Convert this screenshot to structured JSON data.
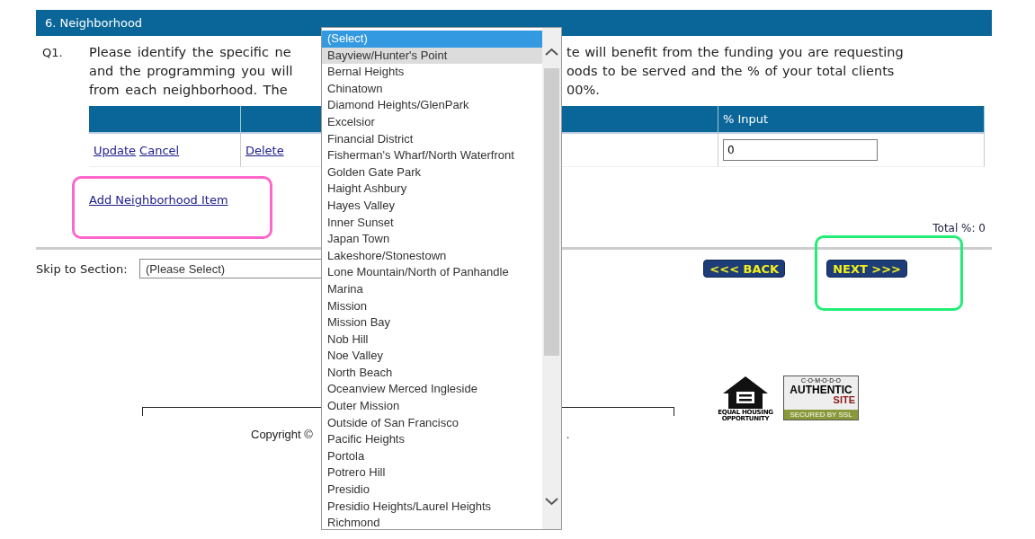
{
  "section": {
    "title": "6. Neighborhood"
  },
  "question": {
    "number": "Q1.",
    "left_lines": [
      "Please identify the specific ne",
      "and the programming you will",
      "from each neighborhood. The"
    ],
    "right_lines": [
      "te will benefit from the funding you are requesting",
      "oods to be served and the % of your total clients",
      "00%."
    ]
  },
  "table": {
    "columns": [
      "",
      "",
      "% Input"
    ],
    "rows": [
      {
        "actions": [
          "Update",
          "Cancel"
        ],
        "delete": "Delete",
        "value": "0"
      }
    ]
  },
  "add_link": "Add Neighborhood Item",
  "total": "Total %: 0",
  "skip": {
    "label": "Skip to Section:",
    "value": "(Please Select)"
  },
  "buttons": [
    {
      "label": "<<< BACK"
    },
    {
      "label": "NEXT >>>"
    }
  ],
  "footer": {
    "copyright": "Copyright ©",
    "tail": "."
  },
  "housing_logo": {
    "lines": [
      "EQUAL HOUSING",
      "OPPORTUNITY"
    ]
  },
  "ssl_badge": {
    "top": "C·O·M·O·D·O",
    "main": "AUTHENTIC",
    "sub": "SITE",
    "bottom": "SECURED BY SSL"
  },
  "dropdown": {
    "options": [
      {
        "label": "(Select)",
        "selected": true,
        "hovered": false
      },
      {
        "label": "Bayview/Hunter's Point",
        "selected": false,
        "hovered": true
      },
      {
        "label": "Bernal Heights",
        "selected": false,
        "hovered": false
      },
      {
        "label": "Chinatown",
        "selected": false,
        "hovered": false
      },
      {
        "label": "Diamond Heights/GlenPark",
        "selected": false,
        "hovered": false
      },
      {
        "label": "Excelsior",
        "selected": false,
        "hovered": false
      },
      {
        "label": "Financial District",
        "selected": false,
        "hovered": false
      },
      {
        "label": "Fisherman's Wharf/North Waterfront",
        "selected": false,
        "hovered": false
      },
      {
        "label": "Golden Gate Park",
        "selected": false,
        "hovered": false
      },
      {
        "label": "Haight Ashbury",
        "selected": false,
        "hovered": false
      },
      {
        "label": "Hayes Valley",
        "selected": false,
        "hovered": false
      },
      {
        "label": "Inner Sunset",
        "selected": false,
        "hovered": false
      },
      {
        "label": "Japan Town",
        "selected": false,
        "hovered": false
      },
      {
        "label": "Lakeshore/Stonestown",
        "selected": false,
        "hovered": false
      },
      {
        "label": "Lone Mountain/North of Panhandle",
        "selected": false,
        "hovered": false
      },
      {
        "label": "Marina",
        "selected": false,
        "hovered": false
      },
      {
        "label": "Mission",
        "selected": false,
        "hovered": false
      },
      {
        "label": "Mission Bay",
        "selected": false,
        "hovered": false
      },
      {
        "label": "Nob Hill",
        "selected": false,
        "hovered": false
      },
      {
        "label": "Noe Valley",
        "selected": false,
        "hovered": false
      },
      {
        "label": "North Beach",
        "selected": false,
        "hovered": false
      },
      {
        "label": "Oceanview Merced Ingleside",
        "selected": false,
        "hovered": false
      },
      {
        "label": "Outer Mission",
        "selected": false,
        "hovered": false
      },
      {
        "label": "Outside of San Francisco",
        "selected": false,
        "hovered": false
      },
      {
        "label": "Pacific Heights",
        "selected": false,
        "hovered": false
      },
      {
        "label": "Portola",
        "selected": false,
        "hovered": false
      },
      {
        "label": "Potrero Hill",
        "selected": false,
        "hovered": false
      },
      {
        "label": "Presidio",
        "selected": false,
        "hovered": false
      },
      {
        "label": "Presidio Heights/Laurel Heights",
        "selected": false,
        "hovered": false
      },
      {
        "label": "Richmond",
        "selected": false,
        "hovered": false
      }
    ]
  },
  "annotations": [
    {
      "color": "#ff66cc"
    },
    {
      "color": "#22ee77"
    }
  ]
}
